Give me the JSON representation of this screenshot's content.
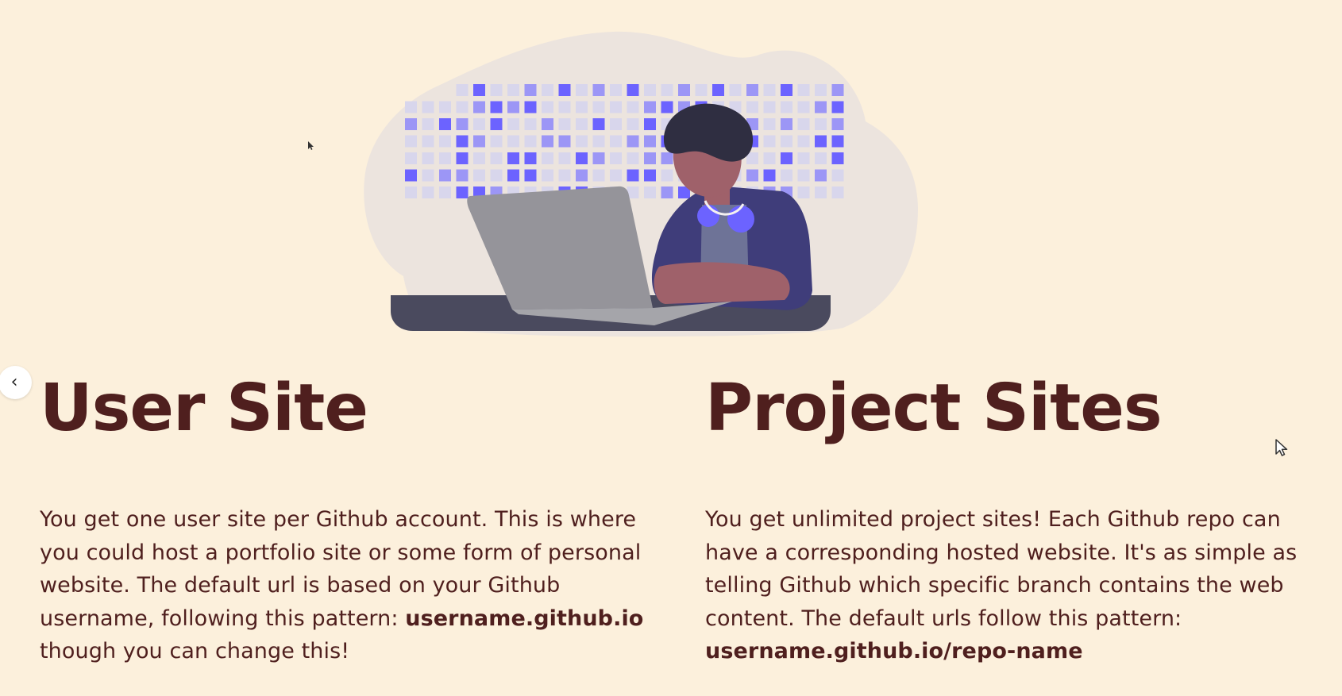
{
  "left_section": {
    "title": "User Site",
    "text_part_1": "You get one user site per Github account.  This is where you could host a portfolio site or some form of personal website.  The default url is based on your Github username, following this pattern: ",
    "bold_pattern": "username.github.io",
    "text_part_2": " though you can change this!"
  },
  "right_section": {
    "title": "Project Sites",
    "text_part_1": "You get unlimited project sites! Each Github repo can have a corresponding hosted website.  It's as simple as telling Github which specific branch contains the web content.  The default urls follow this pattern: ",
    "bold_pattern": "username.github.io/repo-name"
  },
  "nav": {
    "back_icon": "‹"
  },
  "icons": {
    "back": "chevron-left-icon",
    "cursor": "mouse-pointer-icon"
  },
  "colors": {
    "background": "#fcf0dc",
    "text": "#4f1f1e",
    "accent": "#6c63ff",
    "blob": "#ece4de"
  }
}
